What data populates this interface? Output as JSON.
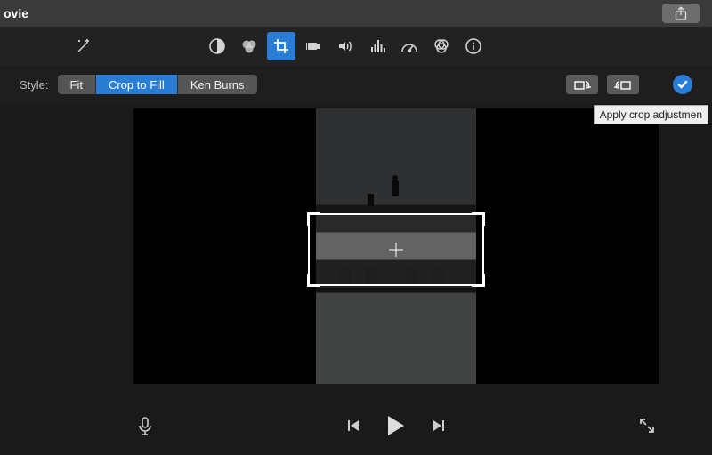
{
  "window": {
    "title": "ovie"
  },
  "share": {
    "name": "share-icon"
  },
  "toolbar": {
    "items": [
      {
        "name": "wand-icon"
      },
      {
        "name": "color-balance-icon"
      },
      {
        "name": "color-wheel-icon"
      },
      {
        "name": "crop-icon",
        "active": true
      },
      {
        "name": "stabilize-icon"
      },
      {
        "name": "volume-icon"
      },
      {
        "name": "equalizer-icon"
      },
      {
        "name": "speed-icon"
      },
      {
        "name": "color-filter-icon"
      },
      {
        "name": "info-icon"
      }
    ]
  },
  "style": {
    "label": "Style:",
    "options": [
      "Fit",
      "Crop to Fill",
      "Ken Burns"
    ],
    "selected": "Crop to Fill"
  },
  "rotate": {
    "left_name": "rotate-ccw-icon",
    "right_name": "rotate-cw-icon"
  },
  "apply": {
    "tooltip": "Apply crop adjustmen"
  },
  "playback": {
    "mic": "microphone-icon",
    "prev": "previous-frame-icon",
    "play": "play-icon",
    "next": "next-frame-icon",
    "fullscreen": "fullscreen-icon"
  }
}
